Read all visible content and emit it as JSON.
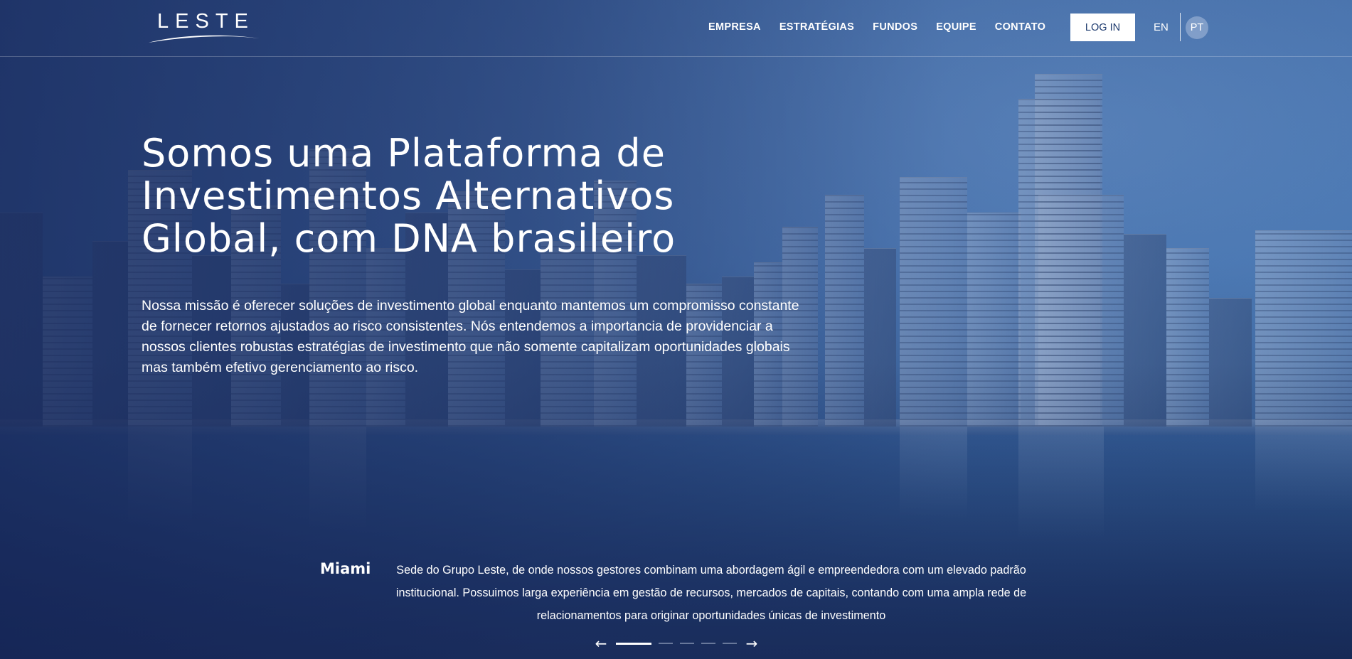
{
  "brand": {
    "logo_text": "LESTE"
  },
  "nav": {
    "items": [
      {
        "label": "EMPRESA"
      },
      {
        "label": "ESTRATÉGIAS"
      },
      {
        "label": "FUNDOS"
      },
      {
        "label": "EQUIPE"
      },
      {
        "label": "CONTATO"
      }
    ],
    "login_label": "LOG IN",
    "lang_en": "EN",
    "lang_pt": "PT"
  },
  "hero": {
    "title": "Somos uma Plataforma de Investimentos Alternativos Global, com DNA brasileiro",
    "description": "Nossa missão é oferecer soluções de investimento global enquanto mantemos um compromisso constante de fornecer retornos ajustados ao risco consistentes. Nós entendemos a importancia de providenciar a nossos clientes robustas estratégias de investimento que não somente capitalizam oportunidades globais mas também efetivo gerenciamento ao risco."
  },
  "slider": {
    "city": "Miami",
    "text": "Sede do Grupo Leste, de onde nossos gestores combinam uma abordagem ágil e empreendedora com um elevado padrão institucional. Possuimos larga experiência em gestão de recursos, mercados de capitais, contando com uma ampla rede de relacionamentos para originar oportunidades únicas de investimento",
    "prev_icon": "arrow-left-icon",
    "next_icon": "arrow-right-icon",
    "dot_count": 5,
    "active_index": 0
  },
  "colors": {
    "overlay_navy": "#1d3a6e",
    "white": "#ffffff"
  }
}
